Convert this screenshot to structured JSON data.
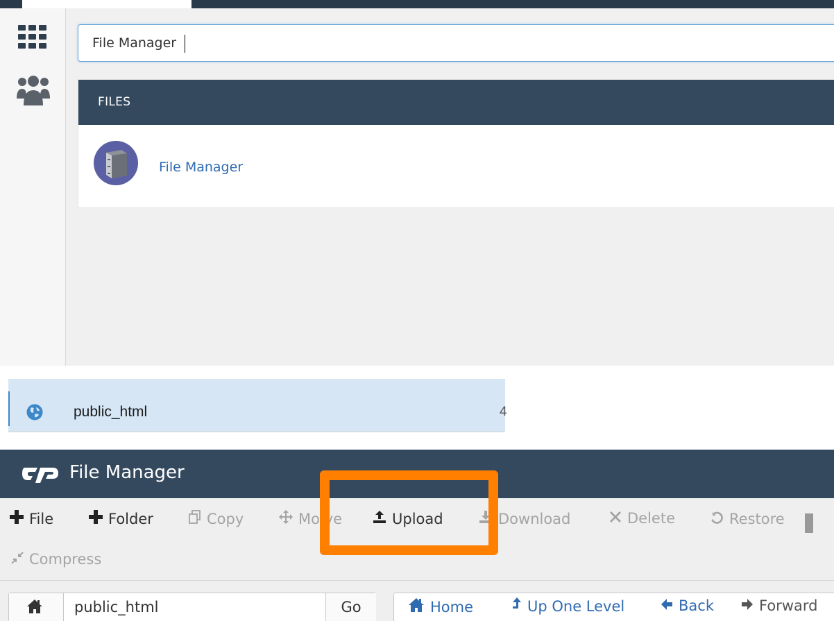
{
  "search": {
    "value": "File Manager"
  },
  "results": {
    "section_label": "FILES",
    "item_label": "File Manager"
  },
  "directory_row": {
    "label": "public_html",
    "meta": "4"
  },
  "file_manager": {
    "title": "File Manager",
    "toolbar": {
      "file": "File",
      "folder": "Folder",
      "copy": "Copy",
      "move": "Mo ve",
      "upload": "Upload",
      "download": "Download",
      "delete": "Delete",
      "restore": "Restore",
      "compress": "Compress"
    },
    "path_bar": {
      "value": "public_html",
      "go_label": "Go"
    },
    "nav": {
      "home": "Home",
      "up": "Up One Level",
      "back": "Back",
      "forward": "Forward"
    }
  },
  "icons": {
    "sidebar": [
      "grid-icon",
      "users-icon"
    ],
    "result": "file-cabinet-icon",
    "row": "globe-icon",
    "logo": "cpanel-logo"
  },
  "colors": {
    "header_bg": "#34495e",
    "link": "#2f6bb1",
    "highlight": "#ff7f00",
    "row_selected": "#d6e6f5"
  }
}
